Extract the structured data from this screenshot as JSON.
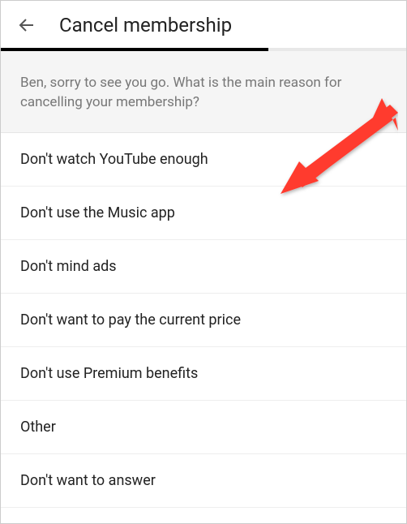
{
  "header": {
    "title": "Cancel membership"
  },
  "prompt": {
    "text": "Ben, sorry to see you go. What is the main reason for cancelling your membership?"
  },
  "options": [
    {
      "label": "Don't watch YouTube enough"
    },
    {
      "label": "Don't use the Music app"
    },
    {
      "label": "Don't mind ads"
    },
    {
      "label": "Don't want to pay the current price"
    },
    {
      "label": "Don't use Premium benefits"
    },
    {
      "label": "Other"
    },
    {
      "label": "Don't want to answer"
    }
  ],
  "progress": {
    "percent": 66
  }
}
